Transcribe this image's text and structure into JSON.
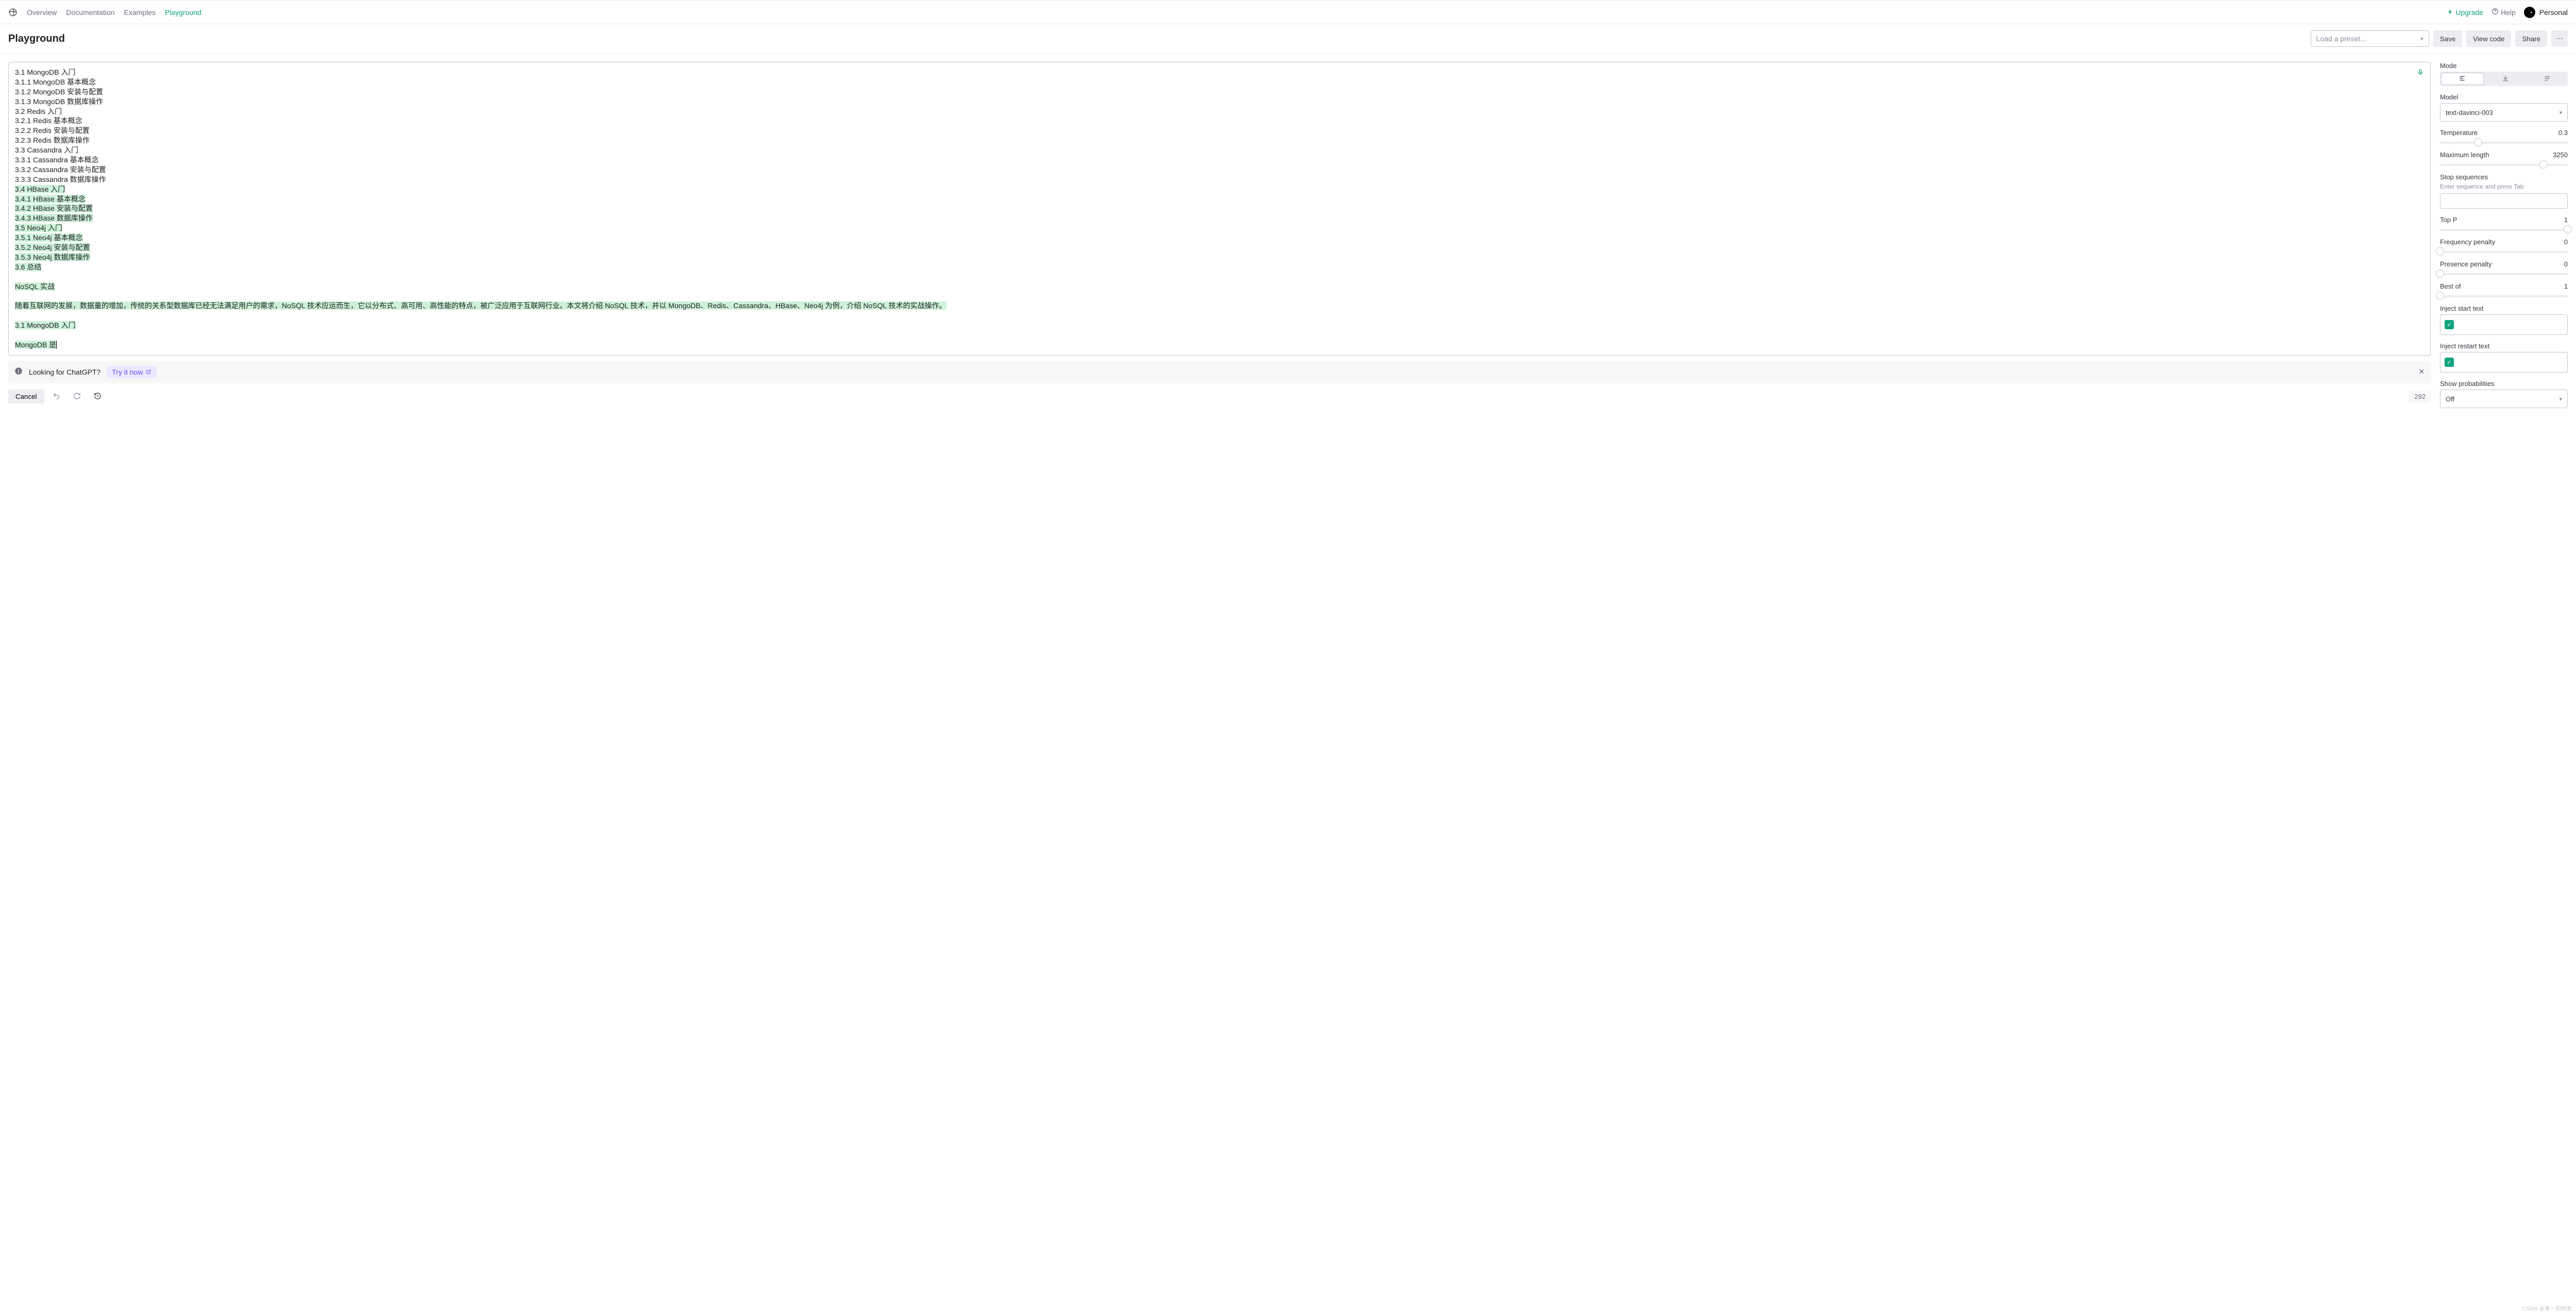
{
  "nav": {
    "items": [
      "Overview",
      "Documentation",
      "Examples",
      "Playground"
    ],
    "active_index": 3,
    "upgrade": "Upgrade",
    "help": "Help",
    "user_label": "Personal"
  },
  "header": {
    "title": "Playground",
    "preset_placeholder": "Load a preset...",
    "save": "Save",
    "view_code": "View code",
    "share": "Share"
  },
  "editor": {
    "plain_lines": [
      "3.1 MongoDB 入门",
      "3.1.1 MongoDB 基本概念",
      "3.1.2 MongoDB 安装与配置",
      "3.1.3 MongoDB 数据库操作",
      "3.2 Redis 入门",
      "3.2.1 Redis 基本概念",
      "3.2.2 Redis 安装与配置",
      "3.2.3 Redis 数据库操作",
      "3.3 Cassandra 入门",
      "3.3.1 Cassandra 基本概念",
      "3.3.2 Cassandra 安装与配置",
      "3.3.3 Cassandra 数据库操作"
    ],
    "highlight_lines": [
      "3.4 HBase 入门",
      "3.4.1 HBase 基本概念",
      "3.4.2 HBase 安装与配置",
      "3.4.3 HBase 数据库操作",
      "3.5 Neo4j 入门",
      "3.5.1 Neo4j 基本概念",
      "3.5.2 Neo4j 安装与配置",
      "3.5.3 Neo4j 数据库操作",
      "3.6 总结",
      "",
      "NoSQL 实战",
      "",
      "随着互联网的发展，数据量的增加，传统的关系型数据库已经无法满足用户的需求，NoSQL 技术应运而生，它以分布式、高可用、高性能的特点，被广泛应用于互联网行业。本文将介绍 NoSQL 技术，并以 MongoDB、Redis、Cassandra、HBase、Neo4j 为例，介绍 NoSQL 技术的实战操作。",
      "",
      "3.1 MongoDB 入门",
      "",
      "MongoDB 是"
    ]
  },
  "banner": {
    "text": "Looking for ChatGPT?",
    "cta": "Try it now"
  },
  "footer": {
    "cancel": "Cancel",
    "token_count": "292"
  },
  "sidebar": {
    "mode_label": "Mode",
    "model_label": "Model",
    "model_value": "text-davinci-003",
    "temperature_label": "Temperature",
    "temperature_value": "0.3",
    "temperature_pct": 30,
    "maxlen_label": "Maximum length",
    "maxlen_value": "3250",
    "maxlen_pct": 81,
    "stop_label": "Stop sequences",
    "stop_hint": "Enter sequence and press Tab",
    "topp_label": "Top P",
    "topp_value": "1",
    "topp_pct": 100,
    "freq_label": "Frequency penalty",
    "freq_value": "0",
    "freq_pct": 0,
    "pres_label": "Presence penalty",
    "pres_value": "0",
    "pres_pct": 0,
    "bestof_label": "Best of",
    "bestof_value": "1",
    "bestof_pct": 0,
    "inject_start_label": "Inject start text",
    "inject_restart_label": "Inject restart text",
    "show_prob_label": "Show probabilities",
    "show_prob_value": "Off"
  },
  "watermark": "CSDN @唯一的阿金"
}
